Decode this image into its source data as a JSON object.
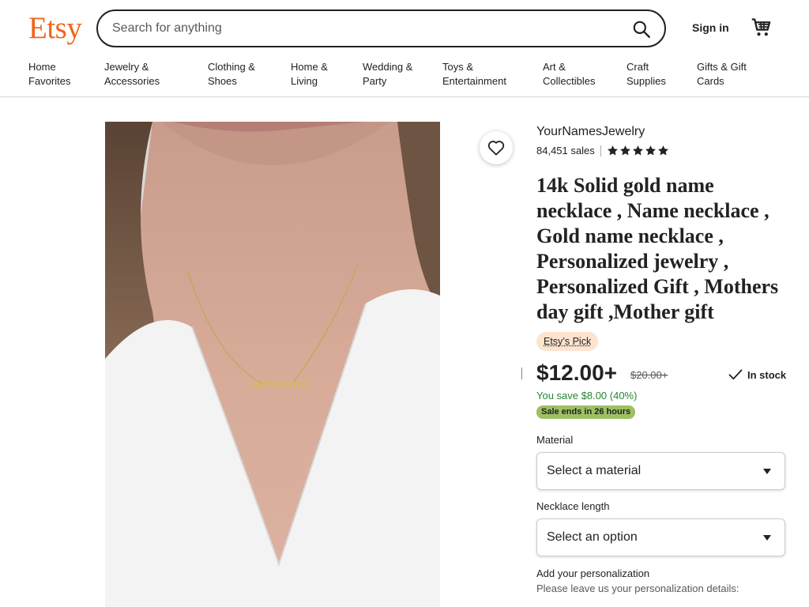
{
  "header": {
    "logo": "Etsy",
    "search_placeholder": "Search for anything",
    "signin": "Sign in"
  },
  "categories": [
    [
      "Home",
      "Favorites"
    ],
    [
      "Jewelry &",
      "Accessories"
    ],
    [
      "Clothing &",
      "Shoes"
    ],
    [
      "Home &",
      "Living"
    ],
    [
      "Wedding &",
      "Party"
    ],
    [
      "Toys &",
      "Entertainment"
    ],
    [
      "Art &",
      "Collectibles"
    ],
    [
      "Craft",
      "Supplies"
    ],
    [
      "Gifts & Gift",
      "Cards"
    ]
  ],
  "product": {
    "image_text": "Adrianna",
    "shop_name": "YourNamesJewelry",
    "sales": "84,451 sales",
    "rating_stars": 5,
    "title": "14k Solid gold name necklace , Name necklace , Gold name necklace , Personalized jewelry , Personalized Gift , Mothers day gift ,Mother gift",
    "badge": "Etsy’s Pick",
    "price": "$12.00+",
    "original_price": "$20.00+",
    "stock": "In stock",
    "savings": "You save $8.00 (40%)",
    "sale_ends": "Sale ends in 26 hours"
  },
  "options": {
    "material_label": "Material",
    "material_value": "Select a material",
    "length_label": "Necklace length",
    "length_value": "Select an option",
    "personalization_label": "Add your personalization",
    "personalization_hint": "Please leave us your personalization details:"
  },
  "colors": {
    "brand": "#f1641e",
    "save_green": "#258635",
    "sale_badge": "#9ec063",
    "pick_badge": "#fde4cf"
  }
}
